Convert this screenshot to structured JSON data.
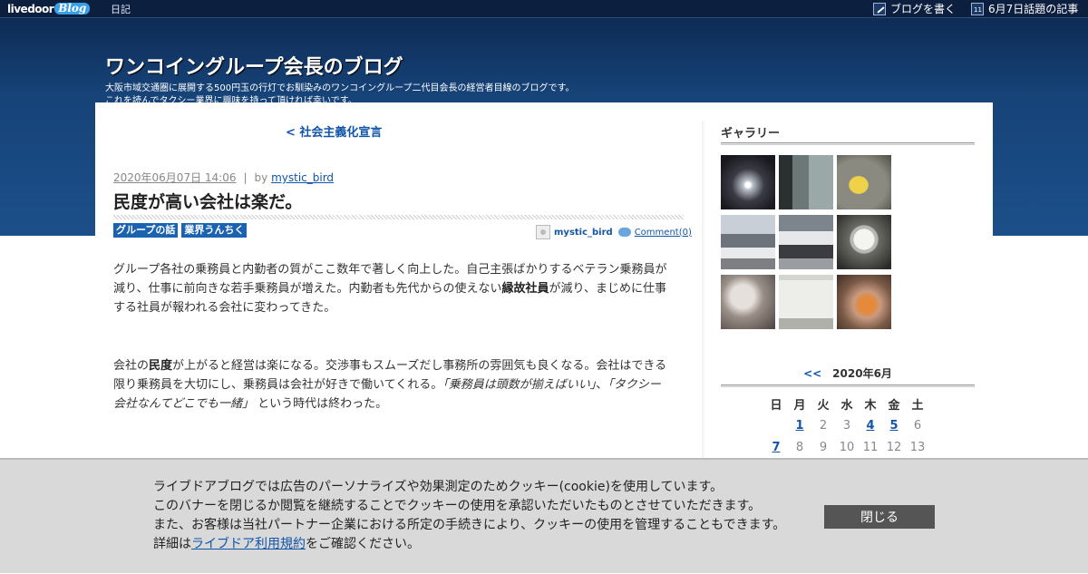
{
  "topbar": {
    "logo_livedoor": "livedoor",
    "logo_blog": "Blog",
    "diary": "日記",
    "write_blog": "ブログを書く",
    "topic_articles": "6月7日話題の記事",
    "calendar_icon_day": "11"
  },
  "header": {
    "title": "ワンコイングループ会長のブログ",
    "desc1": "大阪市域交通圏に展開する500円玉の行灯でお馴染みのワンコイングループ二代目会長の経営者目線のブログです。",
    "desc2": "これを読んでタクシー業界に興味を持って頂ければ幸いです。"
  },
  "post": {
    "prev_link": "< 社会主義化宣言",
    "date": "2020年06月07日 14:06",
    "sep": "|",
    "by": "by",
    "author": "mystic_bird",
    "title": "民度が高い会社は楽だ。",
    "categories": [
      "グループの話",
      "業界うんちく"
    ],
    "info_user": "mystic_bird",
    "comment": "Comment(0)",
    "p1": {
      "a": "グループ各社の乗務員と内勤者の質がここ数年で著しく向上した。自己主張ばかりするベテラン乗務員が減り、仕事に前向きな若手乗務員が増えた。内勤者も先代からの使えない",
      "b": "縁故社員",
      "c": "が減り、まじめに仕事する社員が報われる会社に変わってきた。"
    },
    "p2": {
      "a": "会社の",
      "b": "民度",
      "c": "が上がると経営は楽になる。交渉事もスムーズだし事務所の雰囲気も良くなる。会社はできる限り乗務員を大切にし、乗務員は会社が好きで働いてくれる。",
      "d": "「乗務員は頭数が揃えばいい」",
      "e": "、",
      "f": "「タクシー会社なんてどこでも一緒」",
      "g": " という時代は終わった。"
    }
  },
  "sidebar": {
    "gallery_title": "ギャラリー",
    "calendar_prev": "<<",
    "calendar_title": "2020年6月",
    "weekdays": [
      "日",
      "月",
      "火",
      "水",
      "木",
      "金",
      "土"
    ],
    "weeks": [
      [
        "",
        "1",
        "2",
        "3",
        "4",
        "5",
        "6"
      ],
      [
        "7",
        "8",
        "9",
        "10",
        "11",
        "12",
        "13"
      ]
    ],
    "linked_days": [
      "1",
      "4",
      "5",
      "7"
    ]
  },
  "cookie": {
    "line1": "ライブドアブログでは広告のパーソナライズや効果測定のためクッキー(cookie)を使用しています。",
    "line2": "このバナーを閉じるか閲覧を継続することでクッキーの使用を承認いただいたものとさせていただきます。",
    "line3": "また、お客様は当社パートナー企業における所定の手続きにより、クッキーの使用を管理することもできます。",
    "line4_pre": "詳細は",
    "line4_link": "ライブドア利用規約",
    "line4_post": "をご確認ください。",
    "close": "閉じる"
  },
  "colors": {
    "header_top": "#0e2b55",
    "header_bottom": "#1c4f8a",
    "link": "#1155aa",
    "category_bg": "#1b63b0",
    "cookie_bg": "#d9d9d9",
    "close_bg": "#555555"
  }
}
